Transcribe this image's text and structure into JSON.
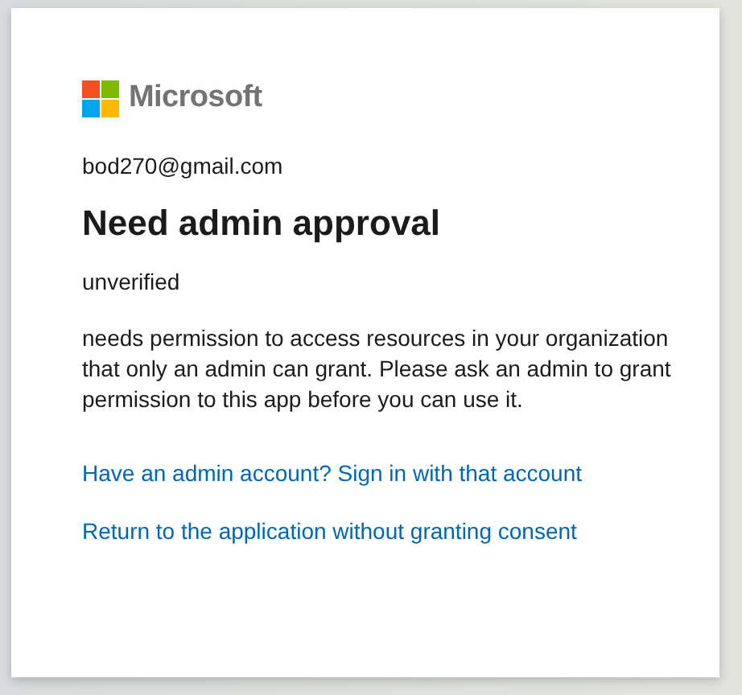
{
  "logo": {
    "wordmark": "Microsoft"
  },
  "account": "bod270@gmail.com",
  "title": "Need admin approval",
  "app_name": "unverified",
  "message": "needs permission to access resources in your organization that only an admin can grant. Please ask an admin to grant permission to this app before you can use it.",
  "links": [
    "Have an admin account? Sign in with that account",
    "Return to the application without granting consent"
  ]
}
